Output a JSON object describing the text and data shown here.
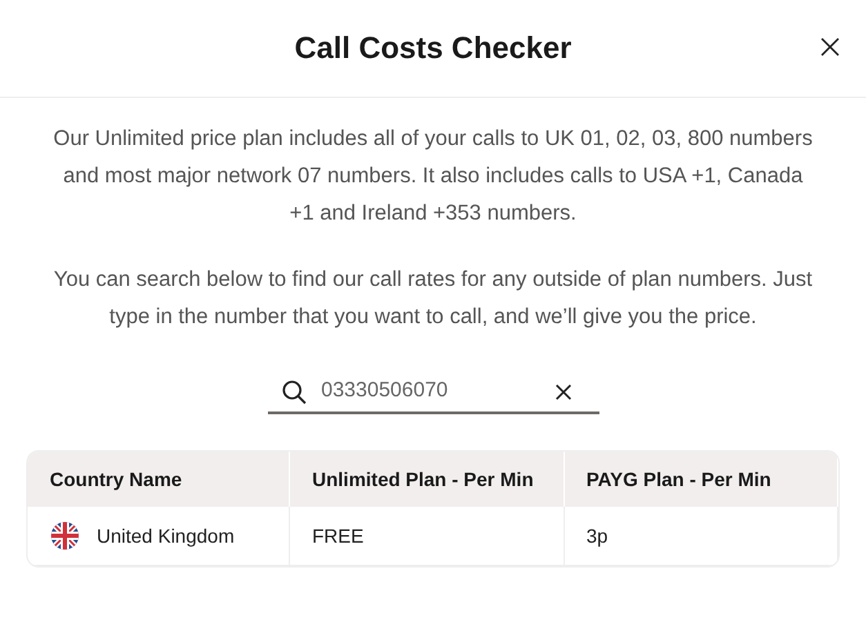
{
  "dialog": {
    "title": "Call Costs Checker"
  },
  "paragraphs": [
    "Our Unlimited price plan includes all of your calls to UK 01, 02, 03, 800 numbers and most major network 07 numbers. It also includes calls to USA +1, Canada +1 and Ireland +353 numbers.",
    "You can search below to find our call rates for any outside of plan numbers. Just type in the number that you want to call, and we’ll give you the price."
  ],
  "search": {
    "value": "03330506070"
  },
  "table": {
    "columns": [
      "Country Name",
      "Unlimited Plan - Per Min",
      "PAYG Plan - Per Min"
    ],
    "rows": [
      {
        "country": "United Kingdom",
        "unlimited": "FREE",
        "payg": "3p"
      }
    ]
  }
}
